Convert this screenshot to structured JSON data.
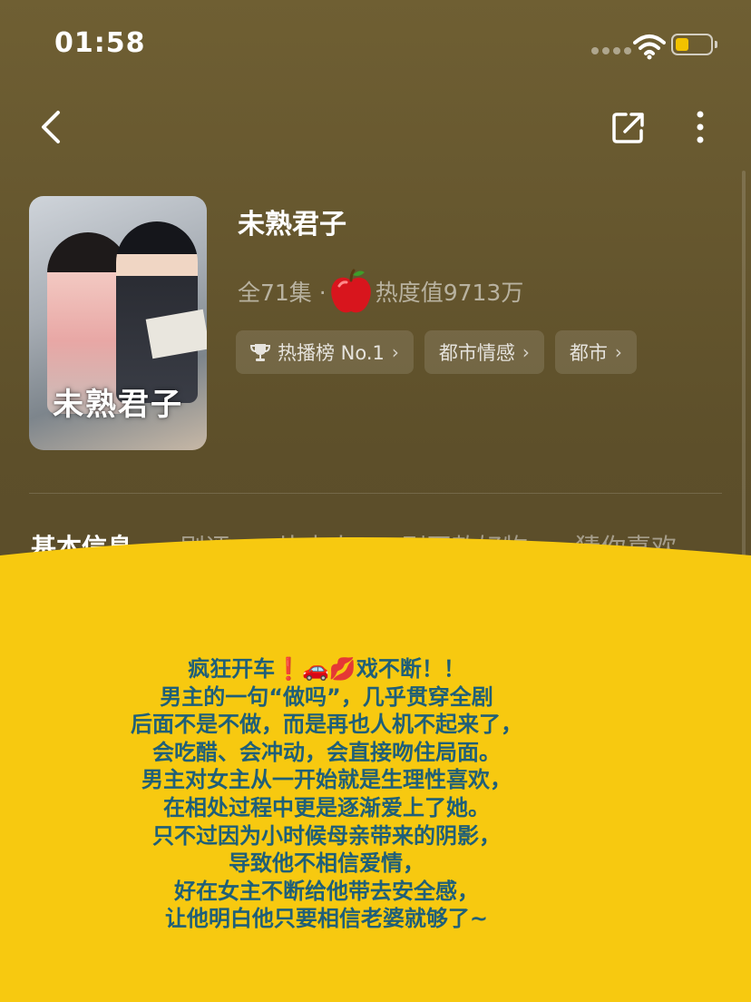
{
  "status_bar": {
    "time": "01:58"
  },
  "drama": {
    "title": "未熟君子",
    "episodes": "全71集 ·",
    "heat": "热度值9713万",
    "poster_title": "未熟君子"
  },
  "tags": [
    {
      "label": "热播榜 No.1",
      "icon": "trophy-icon"
    },
    {
      "label": "都市情感"
    },
    {
      "label": "都市"
    }
  ],
  "tabs": [
    "基本信息",
    "剧评",
    "片中人",
    "剧同款好物",
    "猜你喜欢"
  ],
  "overlay": {
    "lines": [
      "疯狂开车❗️🚗💋戏不断！！",
      "男主的一句“做吗”，几乎贯穿全剧",
      "后面不是不做，而是再也人机不起来了，",
      "会吃醋、会冲动，会直接吻住局面。",
      "男主对女主从一开始就是生理性喜欢，",
      "在相处过程中更是逐渐爱上了她。",
      "只不过因为小时候母亲带来的阴影，",
      "导致他不相信爱情，",
      "好在女主不断给他带去安全感，",
      "让他明白他只要相信老婆就够了~"
    ],
    "color": "#F7C910"
  }
}
